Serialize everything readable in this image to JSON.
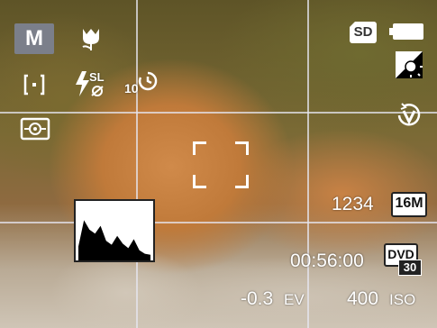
{
  "mode": {
    "label": "M"
  },
  "icons": {
    "macro": "macro-tulip-icon",
    "metering": "spot-metering-icon",
    "flash": "flash-off-icon",
    "self_timer": {
      "name": "self-timer-icon",
      "label": "10"
    },
    "face_detect": "face-detection-icon",
    "sd_card": {
      "name": "sd-card-icon",
      "label": "SD"
    },
    "battery": "battery-full-icon",
    "white_balance": "white-balance-icon",
    "stabilizer": "anti-shake-icon"
  },
  "flash_label": "SL",
  "shots_remaining": "1234",
  "image_size": "16M",
  "record_time": "00:56:00",
  "video": {
    "label": "DVD",
    "fps": "30"
  },
  "exposure": {
    "value": "-0.3",
    "unit": "EV"
  },
  "iso": {
    "value": "400",
    "unit": "ISO"
  },
  "histogram": {
    "levels": [
      0.25,
      0.72,
      0.55,
      0.48,
      0.62,
      0.35,
      0.28,
      0.44,
      0.3,
      0.22,
      0.38,
      0.18,
      0.12,
      0.1
    ]
  },
  "colors": {
    "overlay": "#ffffff",
    "badge_bg": "#7b7f8a"
  }
}
